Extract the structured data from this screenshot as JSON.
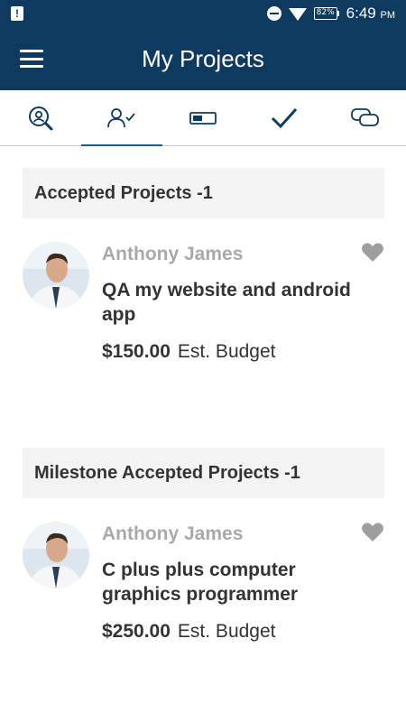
{
  "status_bar": {
    "notification_glyph": "!",
    "battery": "82%",
    "time": "6:49",
    "ampm": "PM"
  },
  "app_bar": {
    "title": "My Projects"
  },
  "tabs": [
    {
      "icon": "search-person-icon",
      "active": false
    },
    {
      "icon": "person-check-icon",
      "active": true
    },
    {
      "icon": "battery-card-icon",
      "active": false
    },
    {
      "icon": "checkmark-icon",
      "active": false
    },
    {
      "icon": "chat-icon",
      "active": false
    }
  ],
  "sections": [
    {
      "title": "Accepted Projects -1",
      "project": {
        "client": "Anthony James",
        "title": "QA my website and android app",
        "amount": "$150.00",
        "budget_label": "Est. Budget"
      }
    },
    {
      "title": "Milestone Accepted Projects -1",
      "project": {
        "client": "Anthony James",
        "title": "C plus plus computer graphics programmer",
        "amount": "$250.00",
        "budget_label": "Est. Budget"
      }
    }
  ],
  "colors": {
    "header": "#0e3a5f",
    "accent": "#1f5c88",
    "muted_text": "#a9a9a9",
    "heart": "#9e9e9e"
  }
}
